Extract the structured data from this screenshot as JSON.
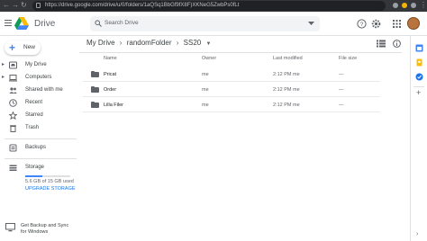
{
  "browser": {
    "url": "https://drive.google.com/drive/u/0/folders/1aQSq1BbGf9fX8F)XKNeG5ZwbPs0fLt"
  },
  "app": {
    "name": "Drive",
    "search_placeholder": "Search Drive"
  },
  "sidebar": {
    "new_label": "New",
    "items": [
      {
        "label": "My Drive",
        "icon": "my-drive-icon",
        "expandable": true
      },
      {
        "label": "Computers",
        "icon": "computer-icon",
        "expandable": true
      },
      {
        "label": "Shared with me",
        "icon": "people-icon",
        "expandable": false
      },
      {
        "label": "Recent",
        "icon": "clock-icon",
        "expandable": false
      },
      {
        "label": "Starred",
        "icon": "star-icon",
        "expandable": false
      },
      {
        "label": "Trash",
        "icon": "trash-icon",
        "expandable": false
      }
    ],
    "backups_label": "Backups",
    "storage_label": "Storage",
    "storage_used": "5.6 GB of 15 GB used",
    "storage_fraction": 0.37,
    "upgrade_label": "UPGRADE STORAGE",
    "backup_sync_label": "Get Backup and Sync for Windows"
  },
  "breadcrumb": [
    "My Drive",
    "randomFolder",
    "SS20"
  ],
  "columns": {
    "name": "Name",
    "owner": "Owner",
    "last_modified": "Last modified",
    "file_size": "File size"
  },
  "files": [
    {
      "name": "Pricat",
      "owner": "me",
      "modified": "2:12 PM me",
      "size": "—"
    },
    {
      "name": "Order",
      "owner": "me",
      "modified": "2:12 PM me",
      "size": "—"
    },
    {
      "name": "Lilla Filer",
      "owner": "me",
      "modified": "2:12 PM me",
      "size": "—"
    }
  ],
  "colors": {
    "accent": "#1a73e8",
    "folder": "#5f6368",
    "chrome": "#35363a"
  }
}
